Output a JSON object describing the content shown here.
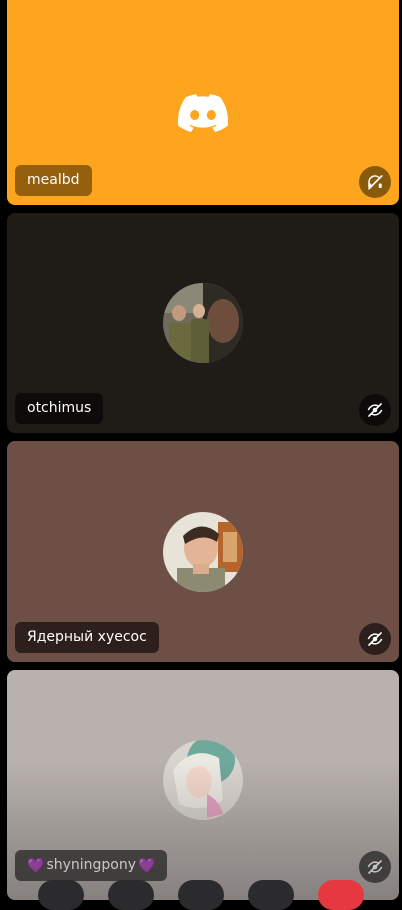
{
  "participants": [
    {
      "name": "mealbd",
      "status_icon": "deafened-icon",
      "tile_color": "#fea520",
      "avatar": "discord-logo-icon"
    },
    {
      "name": "otchimus",
      "status_icon": "video-off-icon",
      "tile_color": "#1f1c18",
      "avatar": "avatar-photo"
    },
    {
      "name": "Ядерный хуесос",
      "status_icon": "video-off-icon",
      "tile_color": "#6e4f46",
      "avatar": "avatar-photo"
    },
    {
      "name": "shyningpony",
      "name_prefix": "💜",
      "name_suffix": "💜",
      "status_icon": "video-off-icon",
      "tile_color": "#b8b1ad",
      "avatar": "avatar-photo"
    }
  ],
  "controls": {
    "end_call_color": "#e5393f"
  }
}
